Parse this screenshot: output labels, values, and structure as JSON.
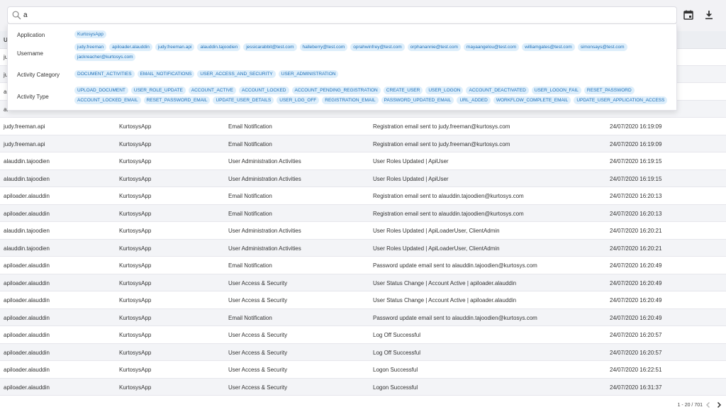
{
  "search": {
    "value": "a"
  },
  "toolbar": {
    "calendar_icon": "calendar-icon",
    "download_icon": "download-icon"
  },
  "dropdown": {
    "sections": [
      {
        "label": "Application",
        "chips": [
          "KurtosysApp"
        ]
      },
      {
        "label": "Username",
        "chips": [
          "judy.freeman",
          "apiloader.alauddin",
          "judy.freeman.api",
          "alauddin.tajoodien",
          "jessicarabbit@test.com",
          "halleberry@test.com",
          "oprahwinfrey@test.com",
          "orphanannie@test.com",
          "mayaangelou@test.com",
          "williamgates@test.com",
          "simonsays@test.com",
          "jackreacher@kurtosys.com"
        ]
      },
      {
        "label": "Activity Category",
        "chips": [
          "DOCUMENT_ACTIVITIES",
          "EMAIL_NOTIFICATIONS",
          "USER_ACCESS_AND_SECURITY",
          "USER_ADMINISTRATION"
        ]
      },
      {
        "label": "Activity Type",
        "chips": [
          "UPLOAD_DOCUMENT",
          "USER_ROLE_UPDATE",
          "ACCOUNT_ACTIVE",
          "ACCOUNT_LOCKED",
          "ACCOUNT_PENDING_REGISTRATION",
          "CREATE_USER",
          "USER_LOGON",
          "ACCOUNT_DEACTIVATED",
          "USER_LOGON_FAIL",
          "RESET_PASSWORD",
          "ACCOUNT_LOCKED_EMAIL",
          "RESET_PASSWORD_EMAIL",
          "UPDATE_USER_DETAILS",
          "USER_LOG_OFF",
          "REGISTRATION_EMAIL",
          "PASSWORD_UPDATED_EMAIL",
          "URL_ADDED",
          "WORKFLOW_COMPLETE_EMAIL",
          "UPDATE_USER_APPLICATION_ACCESS"
        ]
      }
    ]
  },
  "table": {
    "header_first": "U",
    "hidden_row_fragments": [
      "ju",
      "ju",
      "al",
      "al"
    ],
    "rows": [
      [
        "judy.freeman.api",
        "KurtosysApp",
        "Email Notification",
        "Registration email sent to judy.freeman@kurtosys.com",
        "24/07/2020 16:19:09"
      ],
      [
        "judy.freeman.api",
        "KurtosysApp",
        "Email Notification",
        "Registration email sent to judy.freeman@kurtosys.com",
        "24/07/2020 16:19:09"
      ],
      [
        "alauddin.tajoodien",
        "KurtosysApp",
        "User Administration Activities",
        "User Roles Updated | ApiUser",
        "24/07/2020 16:19:15"
      ],
      [
        "alauddin.tajoodien",
        "KurtosysApp",
        "User Administration Activities",
        "User Roles Updated | ApiUser",
        "24/07/2020 16:19:15"
      ],
      [
        "apiloader.alauddin",
        "KurtosysApp",
        "Email Notification",
        "Registration email sent to alauddin.tajoodien@kurtosys.com",
        "24/07/2020 16:20:13"
      ],
      [
        "apiloader.alauddin",
        "KurtosysApp",
        "Email Notification",
        "Registration email sent to alauddin.tajoodien@kurtosys.com",
        "24/07/2020 16:20:13"
      ],
      [
        "alauddin.tajoodien",
        "KurtosysApp",
        "User Administration Activities",
        "User Roles Updated | ApiLoaderUser, ClientAdmin",
        "24/07/2020 16:20:21"
      ],
      [
        "alauddin.tajoodien",
        "KurtosysApp",
        "User Administration Activities",
        "User Roles Updated | ApiLoaderUser, ClientAdmin",
        "24/07/2020 16:20:21"
      ],
      [
        "apiloader.alauddin",
        "KurtosysApp",
        "Email Notification",
        "Password update email sent to alauddin.tajoodien@kurtosys.com",
        "24/07/2020 16:20:49"
      ],
      [
        "apiloader.alauddin",
        "KurtosysApp",
        "User Access & Security",
        "User Status Change | Account Active | apiloader.alauddin",
        "24/07/2020 16:20:49"
      ],
      [
        "apiloader.alauddin",
        "KurtosysApp",
        "User Access & Security",
        "User Status Change | Account Active | apiloader.alauddin",
        "24/07/2020 16:20:49"
      ],
      [
        "apiloader.alauddin",
        "KurtosysApp",
        "Email Notification",
        "Password update email sent to alauddin.tajoodien@kurtosys.com",
        "24/07/2020 16:20:49"
      ],
      [
        "apiloader.alauddin",
        "KurtosysApp",
        "User Access & Security",
        "Log Off Successful",
        "24/07/2020 16:20:57"
      ],
      [
        "apiloader.alauddin",
        "KurtosysApp",
        "User Access & Security",
        "Log Off Successful",
        "24/07/2020 16:20:57"
      ],
      [
        "apiloader.alauddin",
        "KurtosysApp",
        "User Access & Security",
        "Logon Successful",
        "24/07/2020 16:22:51"
      ],
      [
        "apiloader.alauddin",
        "KurtosysApp",
        "User Access & Security",
        "Logon Successful",
        "24/07/2020 16:31:37"
      ]
    ]
  },
  "pagination": {
    "text": "1 - 20 / 701"
  }
}
